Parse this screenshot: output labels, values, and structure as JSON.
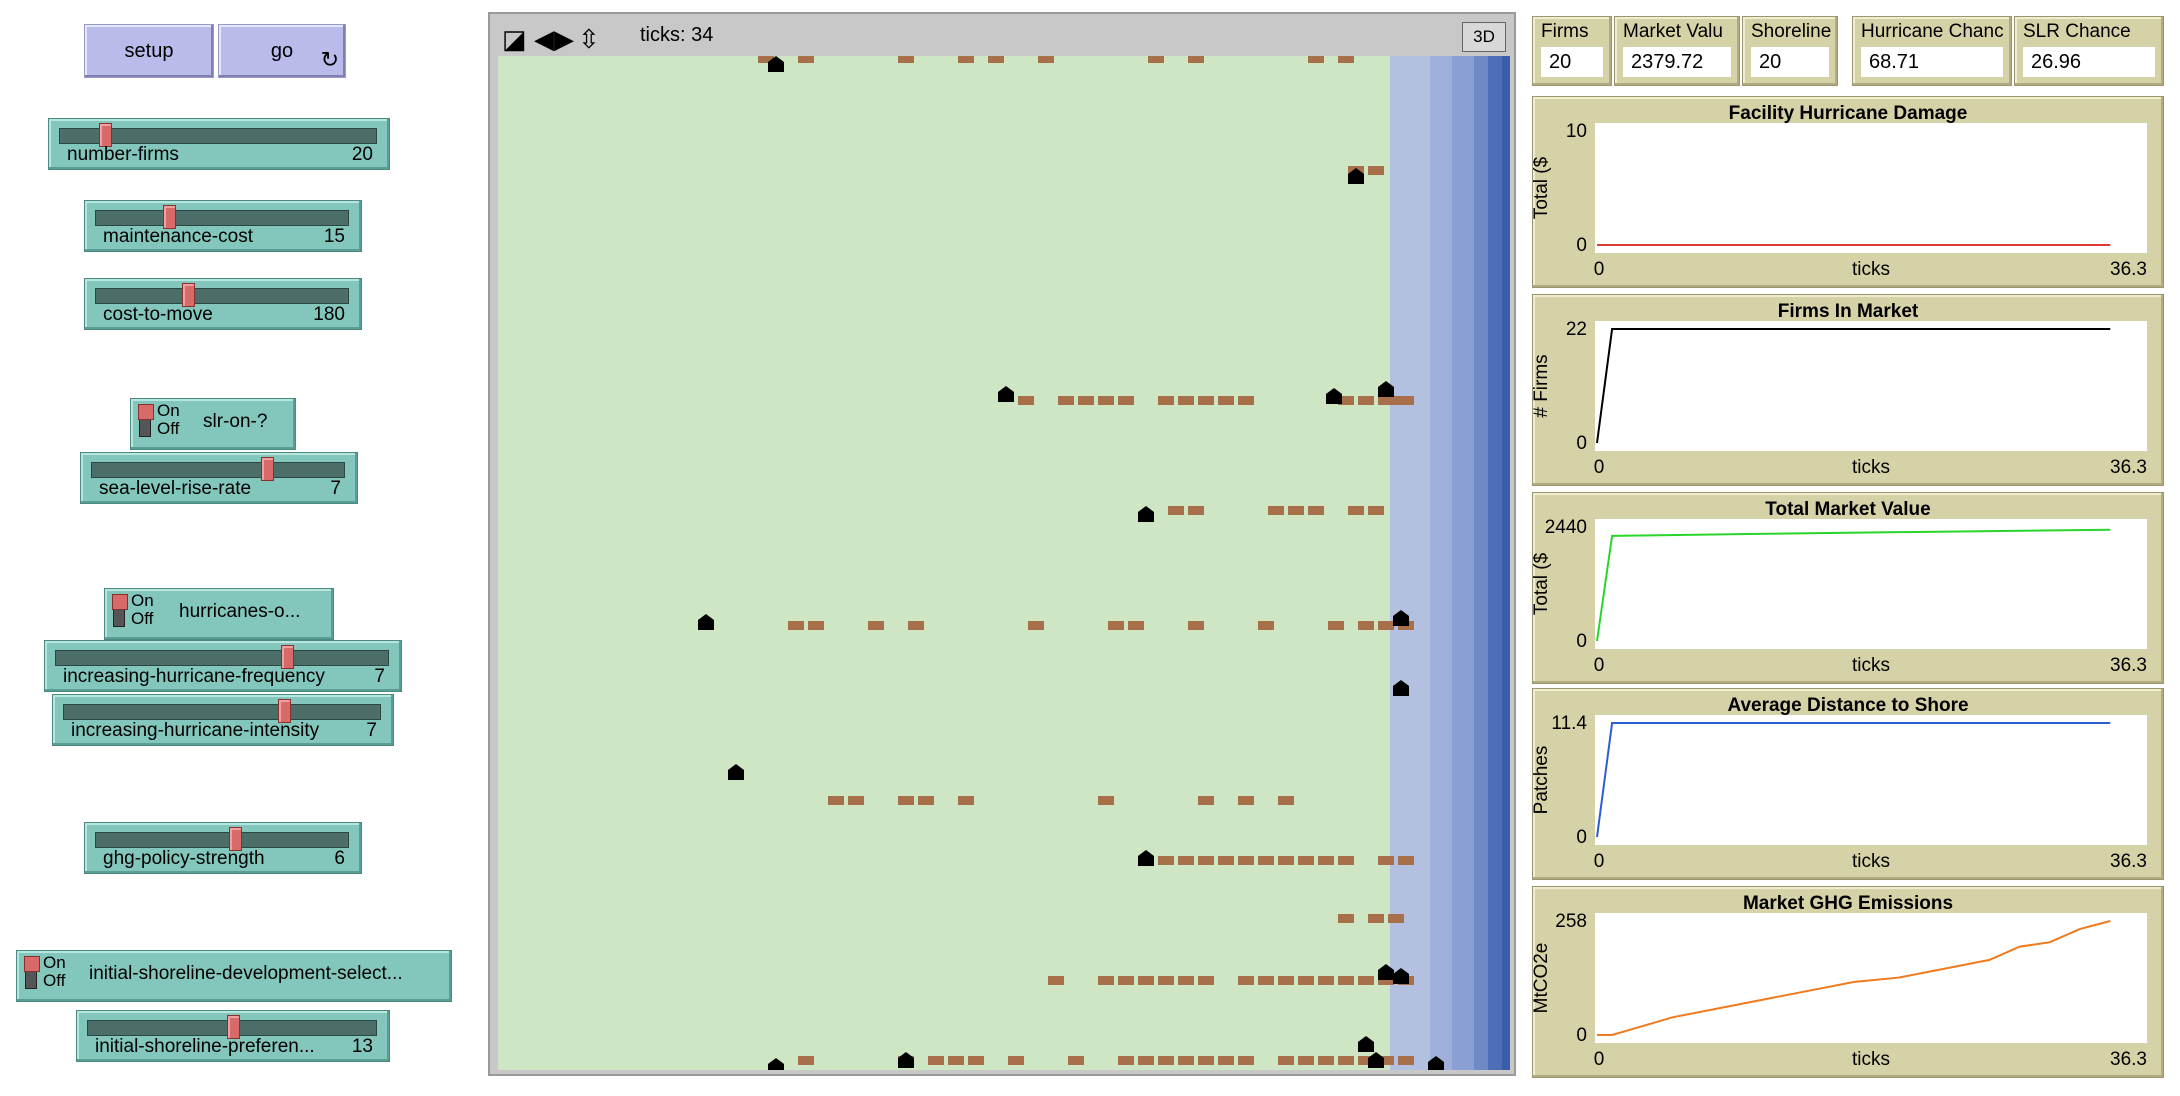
{
  "buttons": {
    "setup": "setup",
    "go": "go",
    "go_forever_icon": "forever-icon"
  },
  "sliders": [
    {
      "label": "number-firms",
      "value": "20",
      "fraction": 0.13
    },
    {
      "label": "maintenance-cost",
      "value": "15",
      "fraction": 0.28
    },
    {
      "label": "cost-to-move",
      "value": "180",
      "fraction": 0.36
    },
    {
      "label": "sea-level-rise-rate",
      "value": "7",
      "fraction": 0.7
    },
    {
      "label": "increasing-hurricane-frequency",
      "value": "7",
      "fraction": 0.7
    },
    {
      "label": "increasing-hurricane-intensity",
      "value": "7",
      "fraction": 0.7
    },
    {
      "label": "ghg-policy-strength",
      "value": "6",
      "fraction": 0.55
    },
    {
      "label": "initial-shoreline-preferen...",
      "value": "13",
      "fraction": 0.5
    }
  ],
  "switches": [
    {
      "label": "slr-on-?",
      "on": "On",
      "off": "Off"
    },
    {
      "label": "hurricanes-o...",
      "on": "On",
      "off": "Off"
    },
    {
      "label": "initial-shoreline-development-select...",
      "on": "On",
      "off": "Off"
    }
  ],
  "view": {
    "ticks_label": "ticks: 34",
    "three_d": "3D"
  },
  "monitors": [
    {
      "label": "Firms",
      "value": "20"
    },
    {
      "label": "Market Valu",
      "value": "2379.72"
    },
    {
      "label": "Shoreline",
      "value": "20"
    },
    {
      "label": "Hurricane Chanc",
      "value": "68.71"
    },
    {
      "label": "SLR Chance",
      "value": "26.96"
    }
  ],
  "colors": {
    "land": "#cfe6c4",
    "water": [
      "#b3c0e0",
      "#9eb0da",
      "#8aa0d4",
      "#6f89c6",
      "#4e6fb8",
      "#3a5ea8"
    ],
    "firm": "#a8704a",
    "facility": "#000000"
  },
  "chart_data": [
    {
      "type": "line",
      "title": "Facility Hurricane Damage",
      "xlabel": "ticks",
      "ylabel": "Total ($",
      "xlim": [
        0,
        36.3
      ],
      "ylim": [
        0,
        10
      ],
      "x_tick_labels": [
        "0",
        "36.3"
      ],
      "y_tick_labels": [
        "0",
        "10"
      ],
      "series": [
        {
          "color": "#e03b30",
          "x": [
            0,
            34
          ],
          "y": [
            0,
            0
          ]
        }
      ]
    },
    {
      "type": "line",
      "title": "Firms In Market",
      "xlabel": "ticks",
      "ylabel": "# Firms",
      "xlim": [
        0,
        36.3
      ],
      "ylim": [
        0,
        22
      ],
      "x_tick_labels": [
        "0",
        "36.3"
      ],
      "y_tick_labels": [
        "0",
        "22"
      ],
      "series": [
        {
          "color": "#000000",
          "x": [
            0,
            1,
            34
          ],
          "y": [
            0,
            22,
            22
          ]
        }
      ]
    },
    {
      "type": "line",
      "title": "Total Market Value",
      "xlabel": "ticks",
      "ylabel": "Total ($",
      "xlim": [
        0,
        36.3
      ],
      "ylim": [
        0,
        2440
      ],
      "x_tick_labels": [
        "0",
        "36.3"
      ],
      "y_tick_labels": [
        "0",
        "2440"
      ],
      "series": [
        {
          "color": "#2ad52a",
          "x": [
            0,
            1,
            10,
            20,
            34
          ],
          "y": [
            0,
            2250,
            2290,
            2330,
            2380
          ]
        }
      ]
    },
    {
      "type": "line",
      "title": "Average Distance to Shore",
      "xlabel": "ticks",
      "ylabel": "Patches",
      "xlim": [
        0,
        36.3
      ],
      "ylim": [
        0,
        11.4
      ],
      "x_tick_labels": [
        "0",
        "36.3"
      ],
      "y_tick_labels": [
        "0",
        "11.4"
      ],
      "series": [
        {
          "color": "#2a5ed5",
          "x": [
            0,
            1,
            34
          ],
          "y": [
            0,
            11.4,
            11.4
          ]
        }
      ]
    },
    {
      "type": "line",
      "title": "Market GHG Emissions",
      "xlabel": "ticks",
      "ylabel": "MtCO2e",
      "xlim": [
        0,
        36.3
      ],
      "ylim": [
        0,
        258
      ],
      "x_tick_labels": [
        "0",
        "36.3"
      ],
      "y_tick_labels": [
        "0",
        "258"
      ],
      "series": [
        {
          "color": "#f07a1e",
          "x": [
            0,
            1,
            3,
            5,
            8,
            11,
            14,
            17,
            20,
            23,
            26,
            28,
            30,
            32,
            34
          ],
          "y": [
            0,
            0,
            20,
            40,
            60,
            80,
            100,
            120,
            130,
            150,
            170,
            200,
            210,
            240,
            258
          ]
        }
      ]
    }
  ]
}
